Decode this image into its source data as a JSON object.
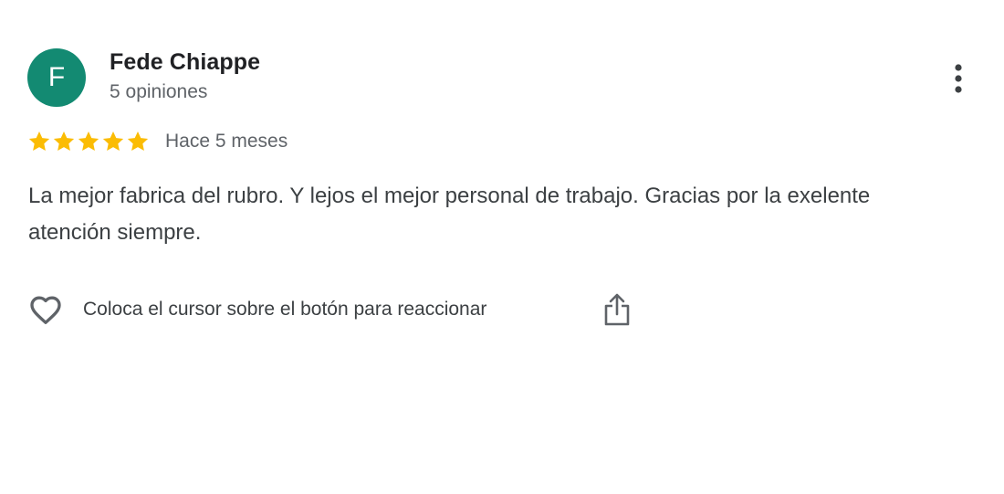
{
  "author": {
    "initial": "F",
    "name": "Fede Chiappe",
    "meta": "5 opiniones",
    "avatar_color": "#138a72"
  },
  "more_menu": {
    "icon": "more-vert-icon"
  },
  "rating": {
    "stars": 5,
    "max_stars": 5,
    "star_color": "#fbbc04",
    "icon": "star-icon",
    "timestamp": "Hace 5 meses"
  },
  "review": {
    "text": "La mejor fabrica del rubro. Y lejos el mejor personal de trabajo. Gracias por la exelente atención siempre."
  },
  "actions": {
    "react_icon": "heart-outline-icon",
    "react_label": "Coloca el cursor sobre el botón para reaccionar",
    "share_icon": "share-icon"
  }
}
